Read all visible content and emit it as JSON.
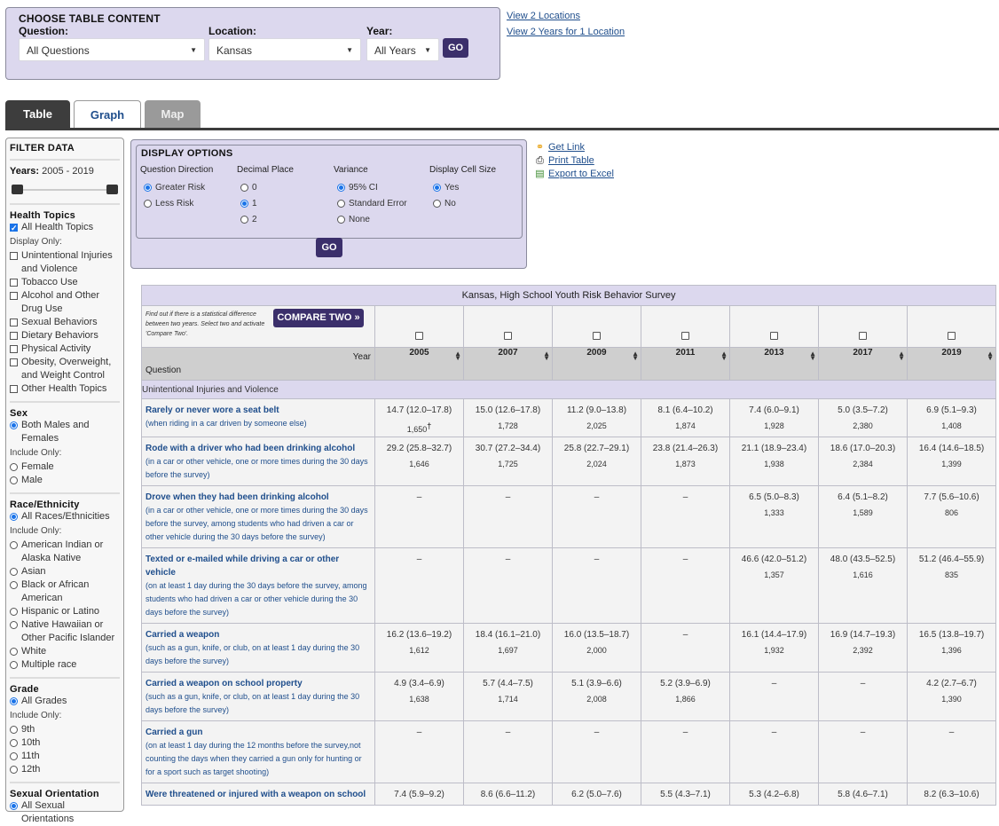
{
  "choose": {
    "title": "CHOOSE TABLE CONTENT",
    "question_label": "Question:",
    "question_value": "All Questions",
    "location_label": "Location:",
    "location_value": "Kansas",
    "year_label": "Year:",
    "year_value": "All Years",
    "go_label": "GO"
  },
  "top_links": [
    "View 2 Locations",
    "View 2 Years for 1 Location"
  ],
  "tabs": [
    {
      "label": "Table",
      "state": "active"
    },
    {
      "label": "Graph",
      "state": "inactive"
    },
    {
      "label": "Map",
      "state": "disabled"
    }
  ],
  "filter": {
    "title": "FILTER DATA",
    "years_label": "Years:",
    "years_range": "2005 - 2019",
    "year_min": 2005,
    "year_max": 2019,
    "health": {
      "title": "Health Topics",
      "all": {
        "label": "All Health Topics",
        "checked": true
      },
      "note": "Display Only:",
      "items": [
        "Unintentional Injuries and Violence",
        "Tobacco Use",
        "Alcohol and Other Drug Use",
        "Sexual Behaviors",
        "Dietary Behaviors",
        "Physical Activity",
        "Obesity, Overweight, and Weight Control",
        "Other Health Topics"
      ]
    },
    "sex": {
      "title": "Sex",
      "all": "Both Males and Females",
      "note": "Include Only:",
      "items": [
        "Female",
        "Male"
      ]
    },
    "race": {
      "title": "Race/Ethnicity",
      "all": "All Races/Ethnicities",
      "note": "Include Only:",
      "items": [
        "American Indian or Alaska Native",
        "Asian",
        "Black or African American",
        "Hispanic or Latino",
        "Native Hawaiian or Other Pacific Islander",
        "White",
        "Multiple race"
      ]
    },
    "grade": {
      "title": "Grade",
      "all": "All Grades",
      "note": "Include Only:",
      "items": [
        "9th",
        "10th",
        "11th",
        "12th"
      ]
    },
    "orientation": {
      "title": "Sexual Orientation",
      "all": "All Sexual Orientations"
    }
  },
  "display": {
    "title": "DISPLAY OPTIONS",
    "direction": {
      "title": "Question Direction",
      "options": [
        "Greater Risk",
        "Less Risk"
      ],
      "selected": "Greater Risk"
    },
    "decimal": {
      "title": "Decimal Place",
      "options": [
        "0",
        "1",
        "2"
      ],
      "selected": "1"
    },
    "variance": {
      "title": "Variance",
      "options": [
        "95% CI",
        "Standard Error",
        "None"
      ],
      "selected": "95% CI"
    },
    "cellsize": {
      "title": "Display Cell Size",
      "options": [
        "Yes",
        "No"
      ],
      "selected": "Yes"
    },
    "go_label": "GO"
  },
  "util_links": [
    {
      "icon": "link-icon",
      "label": "Get Link"
    },
    {
      "icon": "printer-icon",
      "label": "Print Table"
    },
    {
      "icon": "excel-icon",
      "label": "Export to Excel"
    }
  ],
  "table": {
    "caption": "Kansas, High School Youth Risk Behavior Survey",
    "compare_note": "Find out if there is a statistical difference between two years. Select two and activate 'Compare Two'.",
    "compare_label": "COMPARE TWO »",
    "year_header": "Year",
    "question_header": "Question",
    "years": [
      "2005",
      "2007",
      "2009",
      "2011",
      "2013",
      "2017",
      "2019"
    ],
    "topic": "Unintentional Injuries and Violence",
    "rows": [
      {
        "title": "Rarely or never wore a seat belt",
        "desc": "(when riding in a car driven by someone else)",
        "cells": [
          {
            "v": "14.7 (12.0–17.8)",
            "n": "1,650",
            "flag": "†"
          },
          {
            "v": "15.0 (12.6–17.8)",
            "n": "1,728"
          },
          {
            "v": "11.2 (9.0–13.8)",
            "n": "2,025"
          },
          {
            "v": "8.1 (6.4–10.2)",
            "n": "1,874"
          },
          {
            "v": "7.4 (6.0–9.1)",
            "n": "1,928"
          },
          {
            "v": "5.0 (3.5–7.2)",
            "n": "2,380"
          },
          {
            "v": "6.9 (5.1–9.3)",
            "n": "1,408"
          }
        ]
      },
      {
        "title": "Rode with a driver who had been drinking alcohol",
        "desc": "(in a car or other vehicle, one or more times during the 30 days before the survey)",
        "cells": [
          {
            "v": "29.2 (25.8–32.7)",
            "n": "1,646"
          },
          {
            "v": "30.7 (27.2–34.4)",
            "n": "1,725"
          },
          {
            "v": "25.8 (22.7–29.1)",
            "n": "2,024"
          },
          {
            "v": "23.8 (21.4–26.3)",
            "n": "1,873"
          },
          {
            "v": "21.1 (18.9–23.4)",
            "n": "1,938"
          },
          {
            "v": "18.6 (17.0–20.3)",
            "n": "2,384"
          },
          {
            "v": "16.4 (14.6–18.5)",
            "n": "1,399"
          }
        ]
      },
      {
        "title": "Drove when they had been drinking alcohol",
        "desc": "(in a car or other vehicle, one or more times during the 30 days before the survey, among students who had driven a car or other vehicle during the 30 days before the survey)",
        "cells": [
          {
            "v": "–",
            "n": ""
          },
          {
            "v": "–",
            "n": ""
          },
          {
            "v": "–",
            "n": ""
          },
          {
            "v": "–",
            "n": ""
          },
          {
            "v": "6.5 (5.0–8.3)",
            "n": "1,333"
          },
          {
            "v": "6.4 (5.1–8.2)",
            "n": "1,589"
          },
          {
            "v": "7.7 (5.6–10.6)",
            "n": "806"
          }
        ]
      },
      {
        "title": "Texted or e-mailed while driving a car or other vehicle",
        "desc": "(on at least 1 day during the 30 days before the survey, among students who had driven a car or other vehicle during the 30 days before the survey)",
        "cells": [
          {
            "v": "–",
            "n": ""
          },
          {
            "v": "–",
            "n": ""
          },
          {
            "v": "–",
            "n": ""
          },
          {
            "v": "–",
            "n": ""
          },
          {
            "v": "46.6 (42.0–51.2)",
            "n": "1,357"
          },
          {
            "v": "48.0 (43.5–52.5)",
            "n": "1,616"
          },
          {
            "v": "51.2 (46.4–55.9)",
            "n": "835"
          }
        ]
      },
      {
        "title": "Carried a weapon",
        "desc": "(such as a gun, knife, or club, on at least 1 day during the 30 days before the survey)",
        "cells": [
          {
            "v": "16.2 (13.6–19.2)",
            "n": "1,612"
          },
          {
            "v": "18.4 (16.1–21.0)",
            "n": "1,697"
          },
          {
            "v": "16.0 (13.5–18.7)",
            "n": "2,000"
          },
          {
            "v": "–",
            "n": ""
          },
          {
            "v": "16.1 (14.4–17.9)",
            "n": "1,932"
          },
          {
            "v": "16.9 (14.7–19.3)",
            "n": "2,392"
          },
          {
            "v": "16.5 (13.8–19.7)",
            "n": "1,396"
          }
        ]
      },
      {
        "title": "Carried a weapon on school property",
        "desc": "(such as a gun, knife, or club, on at least 1 day during the 30 days before the survey)",
        "cells": [
          {
            "v": "4.9 (3.4–6.9)",
            "n": "1,638"
          },
          {
            "v": "5.7 (4.4–7.5)",
            "n": "1,714"
          },
          {
            "v": "5.1 (3.9–6.6)",
            "n": "2,008"
          },
          {
            "v": "5.2 (3.9–6.9)",
            "n": "1,866"
          },
          {
            "v": "–",
            "n": ""
          },
          {
            "v": "–",
            "n": ""
          },
          {
            "v": "4.2 (2.7–6.7)",
            "n": "1,390"
          }
        ]
      },
      {
        "title": "Carried a gun",
        "desc": "(on at least 1 day during the 12 months before the survey,not counting the days when they carried a gun only for hunting or for a sport such as target shooting)",
        "cells": [
          {
            "v": "–",
            "n": ""
          },
          {
            "v": "–",
            "n": ""
          },
          {
            "v": "–",
            "n": ""
          },
          {
            "v": "–",
            "n": ""
          },
          {
            "v": "–",
            "n": ""
          },
          {
            "v": "–",
            "n": ""
          },
          {
            "v": "–",
            "n": ""
          }
        ]
      },
      {
        "title": "Were threatened or injured with a weapon on school",
        "desc": "",
        "cells": [
          {
            "v": "7.4 (5.9–9.2)",
            "n": ""
          },
          {
            "v": "8.6 (6.6–11.2)",
            "n": ""
          },
          {
            "v": "6.2 (5.0–7.6)",
            "n": ""
          },
          {
            "v": "5.5 (4.3–7.1)",
            "n": ""
          },
          {
            "v": "5.3 (4.2–6.8)",
            "n": ""
          },
          {
            "v": "5.8 (4.6–7.1)",
            "n": ""
          },
          {
            "v": "8.2 (6.3–10.6)",
            "n": ""
          }
        ]
      }
    ]
  }
}
